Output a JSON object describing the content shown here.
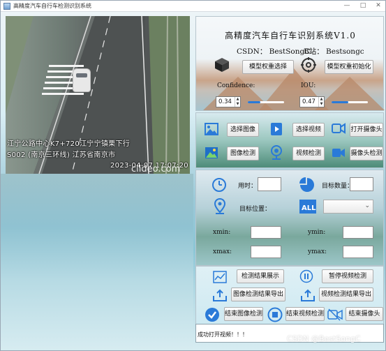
{
  "window": {
    "title": "高精度汽车自行车检测识别系统",
    "controls": {
      "minimize": "—",
      "maximize": "□",
      "close": "✕"
    }
  },
  "video": {
    "overlay_line1": "江宁公路中心K7+720江宁宁镇栗下行",
    "overlay_line2": "S002 (南京三环线) 江苏省南京市",
    "overlay_time": "2023-04-07 17:07:20",
    "watermark": "clideo.com"
  },
  "header": {
    "title": "高精度汽车自行车识别系统V1.0",
    "csdn": "CSDN：  BestSongC",
    "bilibili": "B站：  Bestsongc"
  },
  "model": {
    "select_label": "模型权重选择",
    "init_label": "模型权重初始化"
  },
  "params": {
    "confidence_label": "Confidence:",
    "confidence_value": "0.34",
    "confidence_fraction": 0.34,
    "iou_label": "IOU:",
    "iou_value": "0.47",
    "iou_fraction": 0.47
  },
  "media": {
    "select_image": "选择图像",
    "select_video": "选择视频",
    "open_camera": "打开摄像头",
    "image_detect": "图像检测",
    "video_detect": "视频检测",
    "camera_detect": "摄像头检测"
  },
  "results": {
    "time_label": "用时：",
    "time_value": "",
    "count_label": "目标数量：",
    "count_value": "",
    "position_label": "目标位置：",
    "position_selected": "",
    "xmin_label": "xmin:",
    "ymin_label": "ymin:",
    "xmax_label": "xmax:",
    "ymax_label": "ymax:",
    "all_badge": "ALL"
  },
  "actions": {
    "show_results": "检测结果展示",
    "pause_video": "暂停视频检测",
    "export_image": "图像检测结果导出",
    "export_video": "视频检测结果导出",
    "end_image": "结束图像检测",
    "end_video": "结束视频检测",
    "end_camera": "结束摄像头"
  },
  "status": {
    "message": "成功打开视频！！！"
  },
  "footer": {
    "watermark": "CSDN @BestSongC"
  },
  "colors": {
    "icon_blue": "#2a7ad8",
    "accent_blue": "#3a86e0",
    "slider_fill": "#2a7ad8"
  },
  "icons": [
    "cube-icon",
    "gear-icon",
    "image-icon",
    "video-file-icon",
    "camera-icon",
    "picture-detect-icon",
    "webcam-icon",
    "video-camera-icon",
    "clock-icon",
    "pie-chart-icon",
    "location-pin-icon",
    "all-icon",
    "line-chart-icon",
    "pause-icon",
    "upload-icon",
    "check-circle-icon",
    "stop-icon",
    "camera-off-icon"
  ]
}
